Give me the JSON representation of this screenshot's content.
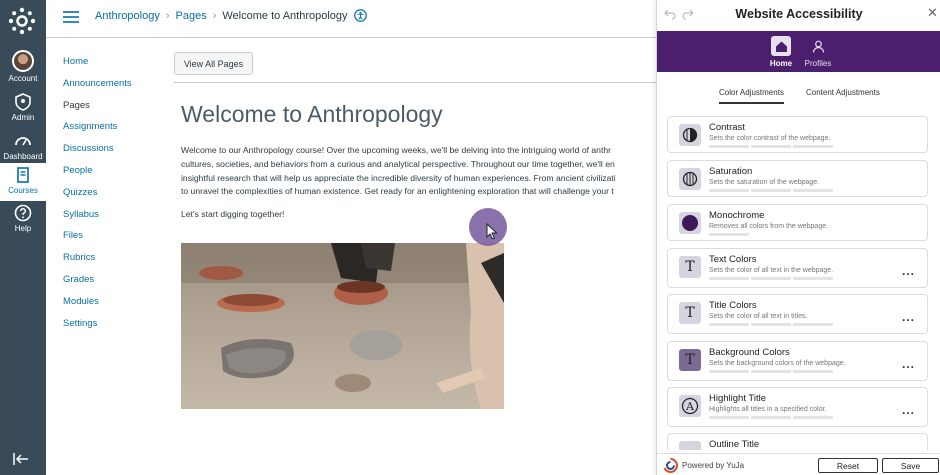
{
  "global_nav": {
    "items": [
      {
        "label": "Account",
        "icon": "avatar"
      },
      {
        "label": "Admin",
        "icon": "shield-icon"
      },
      {
        "label": "Dashboard",
        "icon": "dashboard-icon"
      },
      {
        "label": "Courses",
        "icon": "book-icon"
      },
      {
        "label": "Help",
        "icon": "question-icon"
      }
    ]
  },
  "breadcrumb": {
    "course": "Anthropology",
    "section": "Pages",
    "current": "Welcome to Anthropology"
  },
  "course_nav": {
    "items": [
      {
        "label": "Home"
      },
      {
        "label": "Announcements"
      },
      {
        "label": "Pages"
      },
      {
        "label": "Assignments"
      },
      {
        "label": "Discussions"
      },
      {
        "label": "People"
      },
      {
        "label": "Quizzes"
      },
      {
        "label": "Syllabus"
      },
      {
        "label": "Files"
      },
      {
        "label": "Rubrics"
      },
      {
        "label": "Grades"
      },
      {
        "label": "Modules"
      },
      {
        "label": "Settings"
      }
    ]
  },
  "page": {
    "view_all_label": "View All Pages",
    "title": "Welcome to Anthropology",
    "body_lines": [
      "Welcome to our Anthropology course! Over the upcoming weeks, we'll be delving into the intriguing world of anthr",
      "cultures, societies, and behaviors from a curious and analytical perspective. Throughout our time together, we'll en",
      "insightful research that will help us appreciate the incredible diversity of human experiences. From ancient civilizati",
      "to unravel the complexities of human existence. Get ready for an enlightening exploration that will challenge your t"
    ],
    "closing": "Let's start digging together!"
  },
  "panel": {
    "title": "Website Accessibility",
    "tabs": {
      "home": "Home",
      "profiles": "Profiles"
    },
    "subtabs": {
      "color": "Color Adjustments",
      "content": "Content Adjustments"
    },
    "cards": [
      {
        "title": "Contrast",
        "desc": "Sets the color contrast of the webpage.",
        "icon": "contrast-icon",
        "more": false
      },
      {
        "title": "Saturation",
        "desc": "Sets the saturation of the webpage.",
        "icon": "saturation-icon",
        "more": false
      },
      {
        "title": "Monochrome",
        "desc": "Removes all colors from the webpage.",
        "icon": "monochrome-icon",
        "more": false
      },
      {
        "title": "Text Colors",
        "desc": "Sets the color of all text in the webpage.",
        "icon": "text-color-icon",
        "glyph": "T",
        "more": true
      },
      {
        "title": "Title Colors",
        "desc": "Sets the color of all text in titles.",
        "icon": "title-color-icon",
        "glyph": "T",
        "more": true
      },
      {
        "title": "Background Colors",
        "desc": "Sets the background colors of the webpage.",
        "icon": "background-color-icon",
        "glyph": "T",
        "more": true
      },
      {
        "title": "Highlight Title",
        "desc": "Highlights all titles in a specified color.",
        "icon": "highlight-title-icon",
        "glyph": "A",
        "more": true
      },
      {
        "title": "Outline Title",
        "desc": "",
        "icon": "outline-title-icon",
        "more": false
      }
    ],
    "more_glyph": "...",
    "footer": {
      "powered": "Powered by YuJa",
      "reset": "Reset",
      "save": "Save"
    }
  },
  "colors": {
    "global_nav_bg": "#394b58",
    "link": "#0770a3",
    "panel_banner": "#4b1f6e",
    "accent_purple": "#75589c"
  }
}
